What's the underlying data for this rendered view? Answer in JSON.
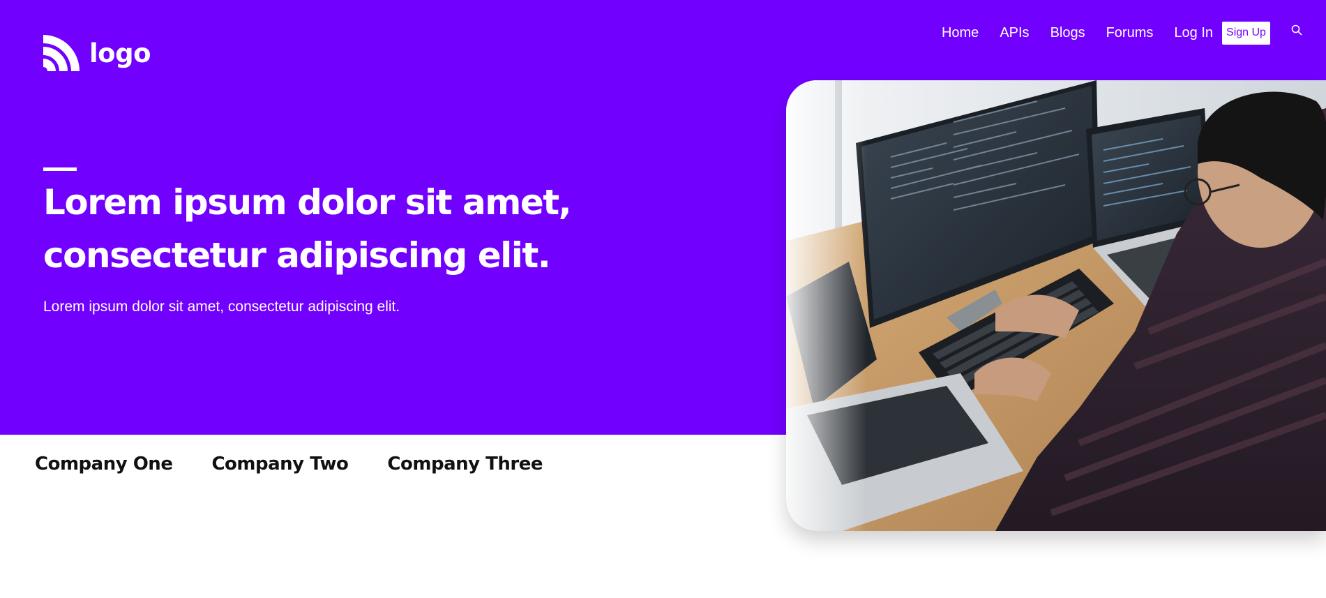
{
  "header": {
    "logo_text": "logo",
    "nav": [
      "Home",
      "APIs",
      "Blogs",
      "Forums",
      "Log In"
    ],
    "signup_label": "Sign Up",
    "search_icon": "search-icon"
  },
  "hero": {
    "headline_line1": "Lorem ipsum dolor sit amet,",
    "headline_line2": "consectetur adipiscing elit.",
    "subheadline": "Lorem ipsum dolor sit amet, consectetur adipiscing elit.",
    "image_alt": "Developer typing code on a keyboard with multiple monitors"
  },
  "companies": [
    "Company One",
    "Company Two",
    "Company Three"
  ],
  "colors": {
    "brand": "#7200ff",
    "white": "#ffffff",
    "text_dark": "#111111"
  }
}
